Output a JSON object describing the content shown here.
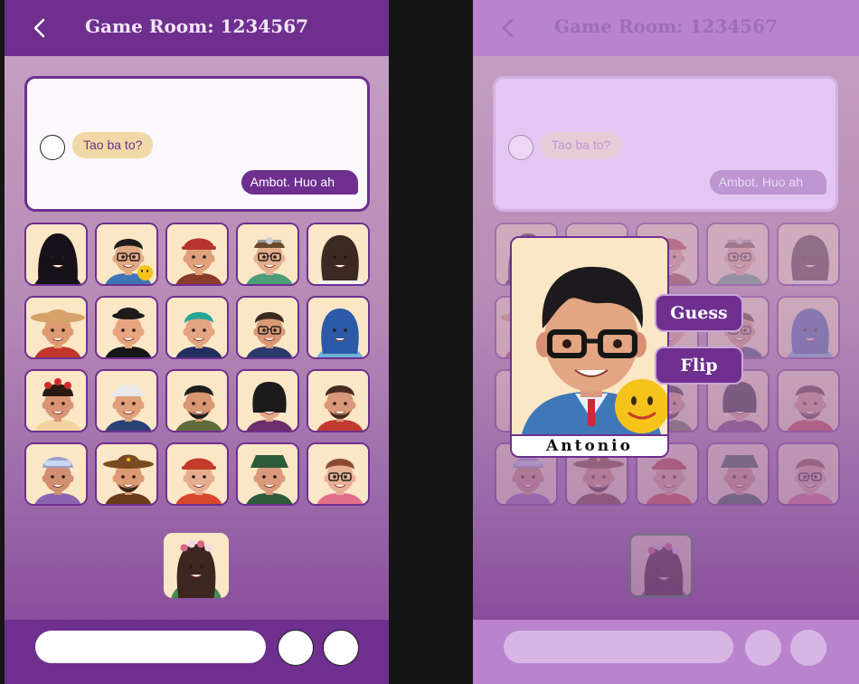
{
  "left": {
    "header": {
      "title": "Game Room: 1234567"
    },
    "chat": {
      "incoming": "Tao ba to?",
      "outgoing": "Ambot. Huo ah"
    },
    "bottom": {
      "message_placeholder": ""
    }
  },
  "right": {
    "header": {
      "title": "Game Room: 1234567"
    },
    "chat": {
      "incoming": "Tao ba to?",
      "outgoing": "Ambot. Huo ah"
    },
    "popup": {
      "character_name": "Antonio",
      "guess_label": "Guess",
      "flip_label": "Flip"
    }
  },
  "colors": {
    "primary": "#6e2f8f",
    "card_bg": "#fbe7c6",
    "incoming_bubble": "#f0d9a6"
  },
  "characters": [
    {
      "skin": "#d99a7c",
      "hair": "#1d1416",
      "shirt": "#1b1b1b",
      "hat": "#17111a",
      "style": "hijab"
    },
    {
      "skin": "#e2a884",
      "hair": "#1b1b1b",
      "shirt": "#3e75b5",
      "hat": "#1b1b1b",
      "style": "glasses"
    },
    {
      "skin": "#dfa07c",
      "hair": "#5a2f1c",
      "shirt": "#8a3b2a",
      "hat": "#b8332e",
      "style": "cap"
    },
    {
      "skin": "#e5ae8c",
      "hair": "#6a4a2e",
      "shirt": "#4d9c7a",
      "hat": "#cfcfcf",
      "style": "doctor"
    },
    {
      "skin": "#dda585",
      "hair": "#3a2a22",
      "shirt": "#f3f3f3",
      "hat": "#3a2a22",
      "style": "long"
    },
    {
      "skin": "#dd9a73",
      "hair": "#4a2d1c",
      "shirt": "#c2372b",
      "hat": "#d4a26a",
      "style": "wide-hat"
    },
    {
      "skin": "#e6a47f",
      "hair": "#b1412a",
      "shirt": "#151515",
      "hat": "#1b1b1b",
      "style": "bowler"
    },
    {
      "skin": "#e3a581",
      "hair": "#2aa59a",
      "shirt": "#1f2e5e",
      "hat": "#2aa59a",
      "style": "teal"
    },
    {
      "skin": "#d99975",
      "hair": "#3b2a20",
      "shirt": "#2a3a6a",
      "hat": "#3b2a20",
      "style": "glasses"
    },
    {
      "skin": "#e2a686",
      "hair": "#2d5aa8",
      "shirt": "#6fb0d6",
      "hat": "#2d5aa8",
      "style": "long"
    },
    {
      "skin": "#d99473",
      "hair": "#2a1a14",
      "shirt": "#f4d3a0",
      "hat": "#cf2b2b",
      "style": "flower"
    },
    {
      "skin": "#e0a07c",
      "hair": "#1d1d1d",
      "shirt": "#2a4077",
      "hat": "#e9e9e9",
      "style": "cap"
    },
    {
      "skin": "#d89672",
      "hair": "#1e1e1e",
      "shirt": "#5f6b3b",
      "hat": "#1e1e1e",
      "style": "beard"
    },
    {
      "skin": "#e4a888",
      "hair": "#1b1b1b",
      "shirt": "#6b2f6a",
      "hat": "#1b1b1b",
      "style": "bob"
    },
    {
      "skin": "#d9977a",
      "hair": "#4a2b1f",
      "shirt": "#c33a2e",
      "hat": "#4a2b1f",
      "style": "beard"
    },
    {
      "skin": "#d08f70",
      "hair": "#2a1a2a",
      "shirt": "#8b64b0",
      "hat": "#9aa0c8",
      "style": "goggles"
    },
    {
      "skin": "#dc9a74",
      "hair": "#3b2418",
      "shirt": "#6a3a1c",
      "hat": "#7a4a22",
      "style": "cowboy"
    },
    {
      "skin": "#e5ad8e",
      "hair": "#dcdcdc",
      "shirt": "#d7482d",
      "hat": "#c23a2a",
      "style": "cap"
    },
    {
      "skin": "#d9997a",
      "hair": "#1d1d1d",
      "shirt": "#2d5b3a",
      "hat": "#2d5b3a",
      "style": "bucket"
    },
    {
      "skin": "#e8b096",
      "hair": "#8a4a32",
      "shirt": "#e2708a",
      "hat": "#8a4a32",
      "style": "glasses"
    }
  ],
  "secret_character": {
    "skin": "#e4a685",
    "hair": "#3b2620",
    "shirt": "#4a8a50",
    "hat": "#d8668a",
    "style": "flower-crown"
  }
}
